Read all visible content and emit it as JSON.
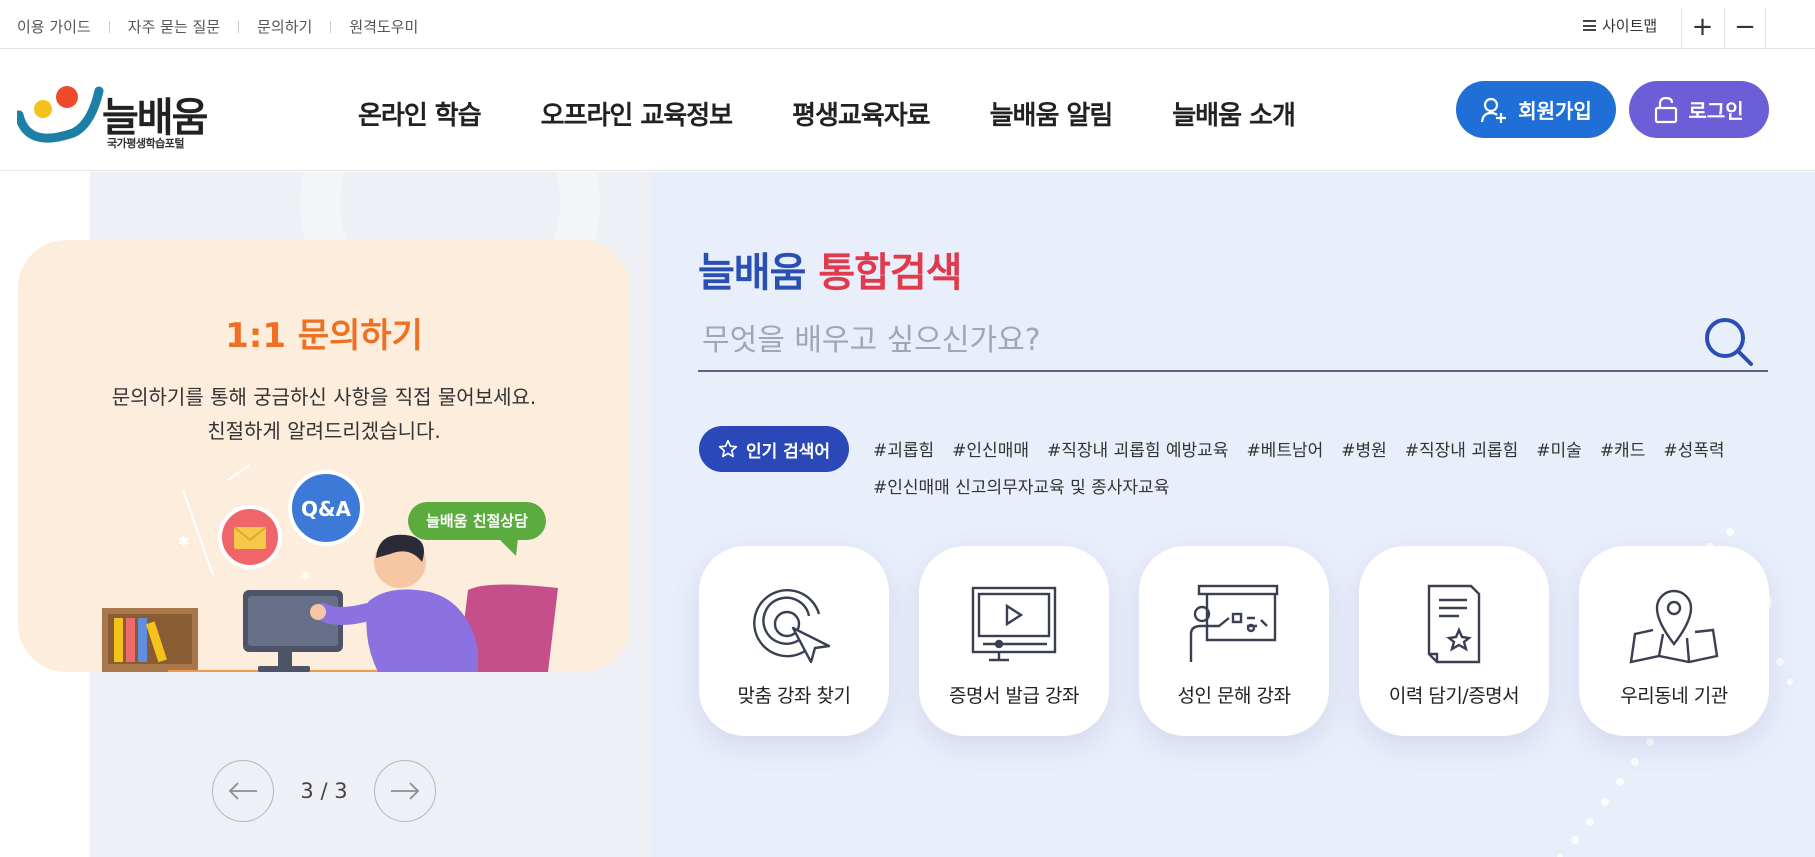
{
  "top_links": [
    "이용 가이드",
    "자주 묻는 질문",
    "문의하기",
    "원격도우미"
  ],
  "sitemap_label": "사이트맵",
  "zoom_in": "+",
  "zoom_out": "−",
  "logo": {
    "brand": "늘배움",
    "subtitle": "국가평생학습포털"
  },
  "nav": [
    "온라인 학습",
    "오프라인 교육정보",
    "평생교육자료",
    "늘배움 알림",
    "늘배움 소개"
  ],
  "join_label": "회원가입",
  "login_label": "로그인",
  "slide": {
    "title": "1:1 문의하기",
    "desc_line1": "문의하기를 통해 궁금하신 사항을 직접 물어보세요.",
    "desc_line2": "친절하게 알려드리겠습니다.",
    "bubble_qa": "Q&A",
    "bubble_chat": "늘배움 친절상담"
  },
  "pager": "3 / 3",
  "search": {
    "title_part1": "늘배움",
    "title_part2": "통합검색",
    "placeholder": "무엇을 배우고 싶으신가요?"
  },
  "popular_label": "인기 검색어",
  "tags": [
    "#괴롭힘",
    "#인신매매",
    "#직장내 괴롭힘 예방교육",
    "#베트남어",
    "#병원",
    "#직장내 괴롭힘",
    "#미술",
    "#캐드",
    "#성폭력",
    "#인신매매 신고의무자교육 및 종사자교육"
  ],
  "quick_links": [
    {
      "label": "맞춤 강좌 찾기",
      "icon": "target-cursor-icon"
    },
    {
      "label": "증명서 발급 강좌",
      "icon": "video-lecture-icon"
    },
    {
      "label": "성인 문해 강좌",
      "icon": "teacher-board-icon"
    },
    {
      "label": "이력 담기/증명서",
      "icon": "certificate-icon"
    },
    {
      "label": "우리동네 기관",
      "icon": "map-pin-icon"
    }
  ],
  "colors": {
    "primary_blue": "#1f6fd6",
    "login_purple": "#6c5ed6",
    "title_red": "#e03a4d",
    "slide_bg": "#fdeddd",
    "slide_title": "#ef7022"
  }
}
